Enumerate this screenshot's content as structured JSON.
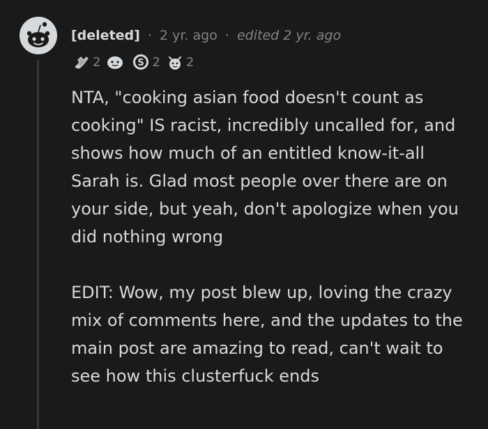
{
  "comment": {
    "author": "[deleted]",
    "separator": "·",
    "time": "2 yr. ago",
    "edited": "edited 2 yr. ago",
    "awards": [
      {
        "icon": "helpful-hand-award-icon",
        "count": "2"
      },
      {
        "icon": "wholesome-award-icon",
        "count": ""
      },
      {
        "icon": "silver-award-icon",
        "count": "2"
      },
      {
        "icon": "cheering-award-icon",
        "count": "2"
      }
    ],
    "paragraphs": [
      "NTA, \"cooking asian food doesn't count as cooking\" IS racist, incredibly uncalled for, and shows how much of an entitled know-it-all Sarah is. Glad most people over there are on your side, but yeah, don't apologize when you did nothing wrong",
      "EDIT: Wow, my post blew up, loving the crazy mix of comments here, and the updates to the main post are amazing to read, can't wait to see how this clusterfuck ends"
    ]
  },
  "colors": {
    "background": "#1a1a1b",
    "text": "#d7dadc",
    "meta": "#818384",
    "thread_line": "#343536"
  }
}
